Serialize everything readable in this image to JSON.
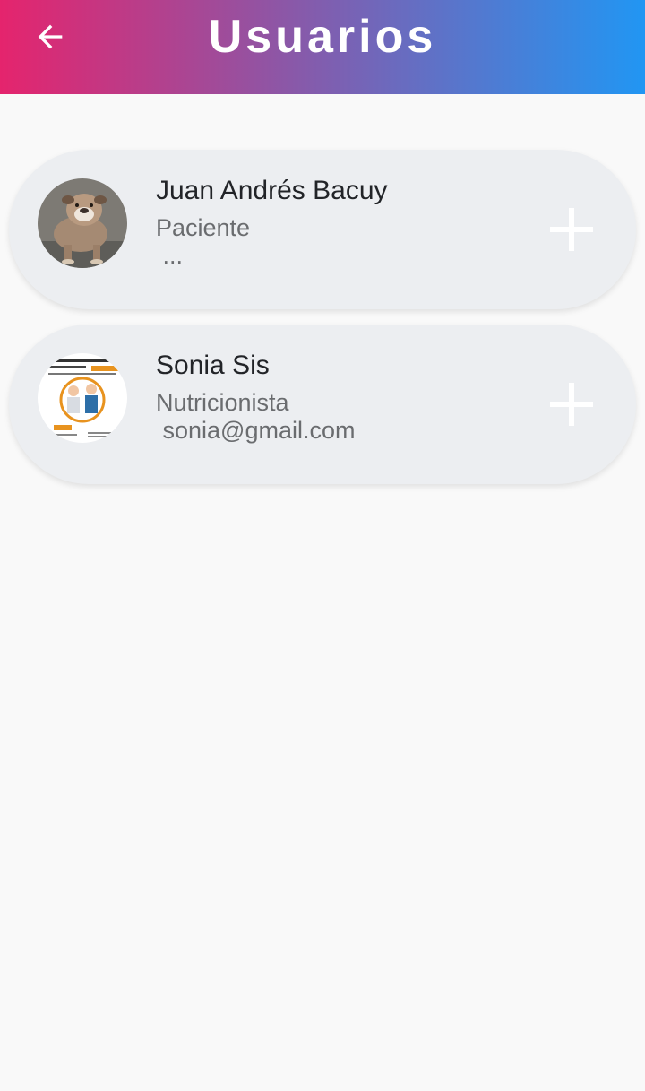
{
  "appbar": {
    "title": "Usuarios",
    "back_icon": "arrow-back-icon",
    "gradient": [
      "#e5246d",
      "#2196f3"
    ]
  },
  "users": [
    {
      "name": "Juan Andrés Bacuy",
      "role": "Paciente",
      "email": " ...",
      "avatar_icon": "bulldog-photo-avatar",
      "action_icon": "plus-icon"
    },
    {
      "name": "Sonia Sis",
      "role": "Nutricionista",
      "email": " sonia@gmail.com",
      "avatar_icon": "nutrition-poster-avatar",
      "action_icon": "plus-icon"
    }
  ]
}
